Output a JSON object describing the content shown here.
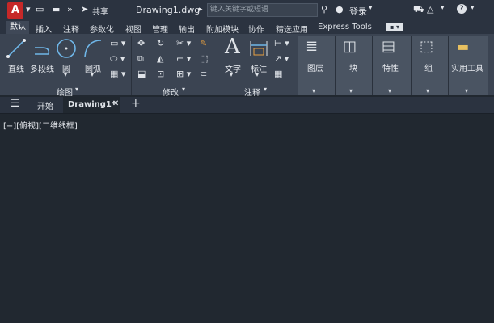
{
  "titlebar": {
    "logo": "A",
    "share_label": "共享",
    "title": "Drawing1.dwg",
    "search_placeholder": "键入关键字或短语",
    "login_label": "登录",
    "help_label": "?"
  },
  "tabs": [
    "默认",
    "插入",
    "注释",
    "参数化",
    "视图",
    "管理",
    "输出",
    "附加模块",
    "协作",
    "精选应用",
    "Express Tools"
  ],
  "ribbon": {
    "draw": {
      "line": "直线",
      "polyline": "多段线",
      "circle": "圆",
      "arc": "圆弧",
      "panel_label": "绘图"
    },
    "modify": {
      "panel_label": "修改"
    },
    "annotation": {
      "text": "文字",
      "dimension": "标注",
      "panel_label": "注释"
    },
    "layers": "图层",
    "block": "块",
    "properties": "特性",
    "group": "组",
    "utilities": "实用工具"
  },
  "filetabs": {
    "start": "开始",
    "drawing": "Drawing1*"
  },
  "viewport": {
    "label": "[−][俯视][二维线框]"
  }
}
